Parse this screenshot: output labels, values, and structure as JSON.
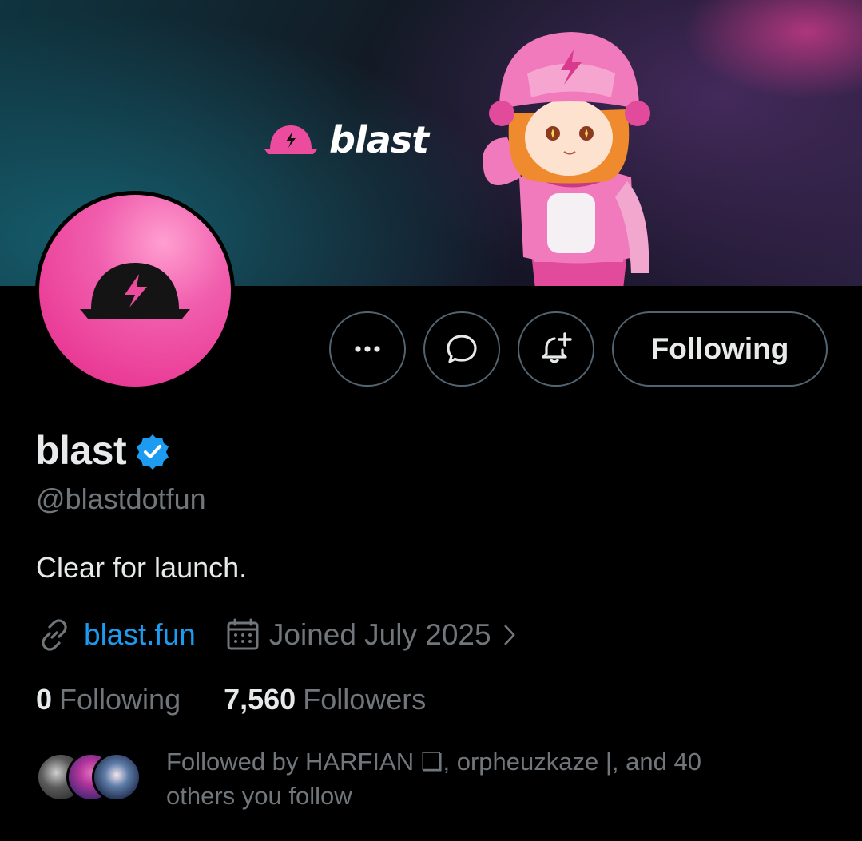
{
  "banner": {
    "wordmark": "blast",
    "brand_pink": "#ec4c9e"
  },
  "actions": {
    "more_icon": "more-horizontal-icon",
    "message_icon": "message-icon",
    "notify_icon": "bell-plus-icon",
    "following_label": "Following"
  },
  "profile": {
    "display_name": "blast",
    "verified": true,
    "handle": "@blastdotfun",
    "bio": "Clear for launch.",
    "website": "blast.fun",
    "joined": "Joined July 2025",
    "following_count": "0",
    "following_label": "Following",
    "followers_count": "7,560",
    "followers_label": "Followers",
    "followed_by": "Followed by HARFIAN ❏, orpheuzkaze |, and 40 others you follow"
  },
  "colors": {
    "background": "#000000",
    "text": "#e7e9ea",
    "muted": "#71767b",
    "link": "#1d9bf0",
    "border": "#536471",
    "verified": "#1d9bf0"
  }
}
